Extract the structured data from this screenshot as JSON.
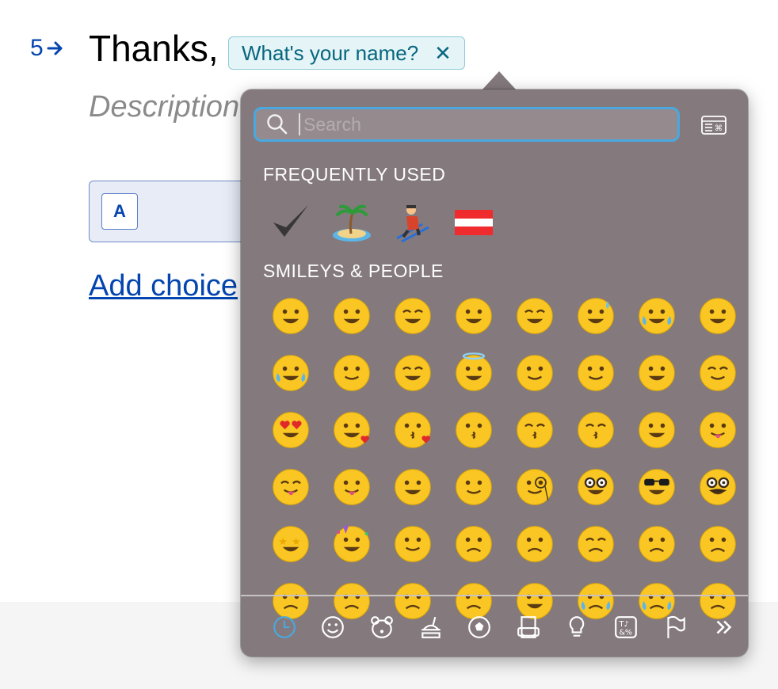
{
  "form": {
    "question_number": "5",
    "question_title": "Thanks,",
    "recall_label": "What's your name?",
    "recall_remove": "✕",
    "description_placeholder": "Description",
    "choice_key": "A",
    "add_choice_label": "Add choice"
  },
  "emoji_picker": {
    "search_placeholder": "Search",
    "search_value": "",
    "frequently_used_title": "FREQUENTLY USED",
    "frequently_used": [
      {
        "name": "heavy-check-mark-emoji",
        "char": "✔️"
      },
      {
        "name": "desert-island-emoji",
        "char": "🏝️"
      },
      {
        "name": "skier-emoji",
        "char": "⛷️"
      },
      {
        "name": "austria-flag-emoji",
        "char": "🇦🇹"
      }
    ],
    "smileys_title": "SMILEYS & PEOPLE",
    "smileys": [
      "grinning-face",
      "grinning-face-big-eyes",
      "grinning-face-smiling-eyes",
      "beaming-face",
      "grinning-squinting-face",
      "grinning-face-sweat",
      "face-tears-of-joy",
      "rolling-on-floor-laughing",
      "face-holding-back-tears",
      "smiling-face",
      "smiling-face-smiling-eyes",
      "smiling-face-halo",
      "slightly-smiling-face",
      "upside-down-face",
      "winking-face",
      "relieved-face",
      "smiling-face-heart-eyes",
      "smiling-face-hearts",
      "face-blowing-kiss",
      "kissing-face",
      "kissing-face-smiling-eyes",
      "kissing-face-closed-eyes",
      "face-savoring-food",
      "face-with-tongue",
      "squinting-face-tongue",
      "winking-face-tongue",
      "zany-face",
      "face-raised-eyebrow",
      "face-with-monocle",
      "nerd-face",
      "smiling-face-sunglasses",
      "disguised-face",
      "star-struck",
      "partying-face",
      "smirking-face",
      "unamused-face",
      "disappointed-face",
      "pensive-face",
      "worried-face",
      "confused-face",
      "persevering-face",
      "confounded-face",
      "tired-face",
      "weary-face",
      "pleading-face",
      "crying-face",
      "loudly-crying-face",
      "face-steam-from-nose"
    ],
    "categories": [
      {
        "name": "recent-category-icon",
        "active": true
      },
      {
        "name": "smileys-category-icon",
        "active": false
      },
      {
        "name": "animals-category-icon",
        "active": false
      },
      {
        "name": "food-category-icon",
        "active": false
      },
      {
        "name": "activity-category-icon",
        "active": false
      },
      {
        "name": "travel-category-icon",
        "active": false
      },
      {
        "name": "objects-category-icon",
        "active": false
      },
      {
        "name": "symbols-category-icon",
        "active": false
      },
      {
        "name": "flags-category-icon",
        "active": false
      },
      {
        "name": "more-categories-icon",
        "active": false
      }
    ],
    "colors": {
      "panel": "#847a7d",
      "accent": "#4aa8e0",
      "emoji_face": "#f9c623",
      "link": "#0445af",
      "recall_text": "#06677e"
    }
  }
}
